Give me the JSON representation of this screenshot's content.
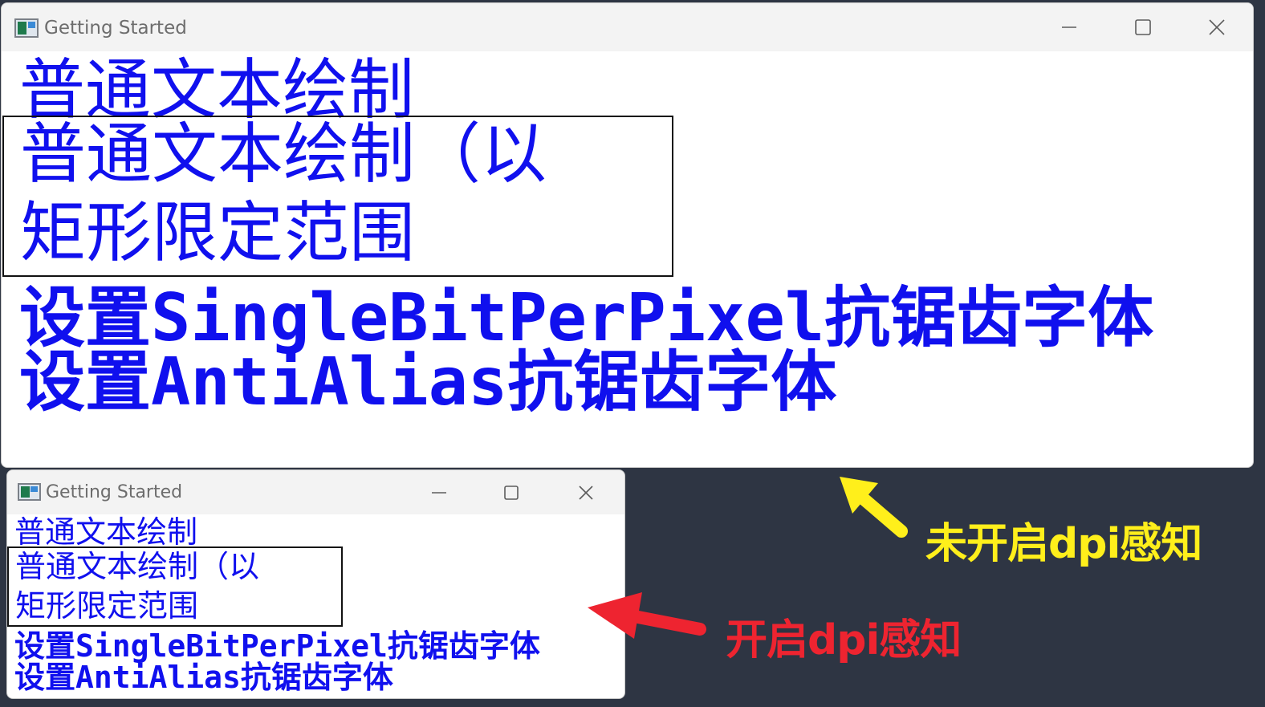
{
  "colors": {
    "desktop_background": "#2e3543",
    "text_blue": "#1010ee",
    "annotation_yellow": "#ffef1b",
    "annotation_red": "#ee2430"
  },
  "windows": [
    {
      "id": "without-dpi-awareness",
      "title": "Getting Started",
      "app_icon": "app-icon",
      "controls": [
        "minimize-icon",
        "maximize-icon",
        "close-icon"
      ],
      "content": {
        "normal_text": "普通文本绘制",
        "rect_text_line1": "普通文本绘制（以",
        "rect_text_line2": "矩形限定范围",
        "single_bit_text": "设置SingleBitPerPixel抗锯齿字体",
        "antialias_text": "设置AntiAlias抗锯齿字体"
      }
    },
    {
      "id": "with-dpi-awareness",
      "title": "Getting Started",
      "app_icon": "app-icon",
      "controls": [
        "minimize-icon",
        "maximize-icon",
        "close-icon"
      ],
      "content": {
        "normal_text": "普通文本绘制",
        "rect_text_line1": "普通文本绘制（以",
        "rect_text_line2": "矩形限定范围",
        "single_bit_text": "设置SingleBitPerPixel抗锯齿字体",
        "antialias_text": "设置AntiAlias抗锯齿字体"
      }
    }
  ],
  "annotations": {
    "no_dpi_label": "未开启dpi感知",
    "dpi_label": "开启dpi感知"
  }
}
